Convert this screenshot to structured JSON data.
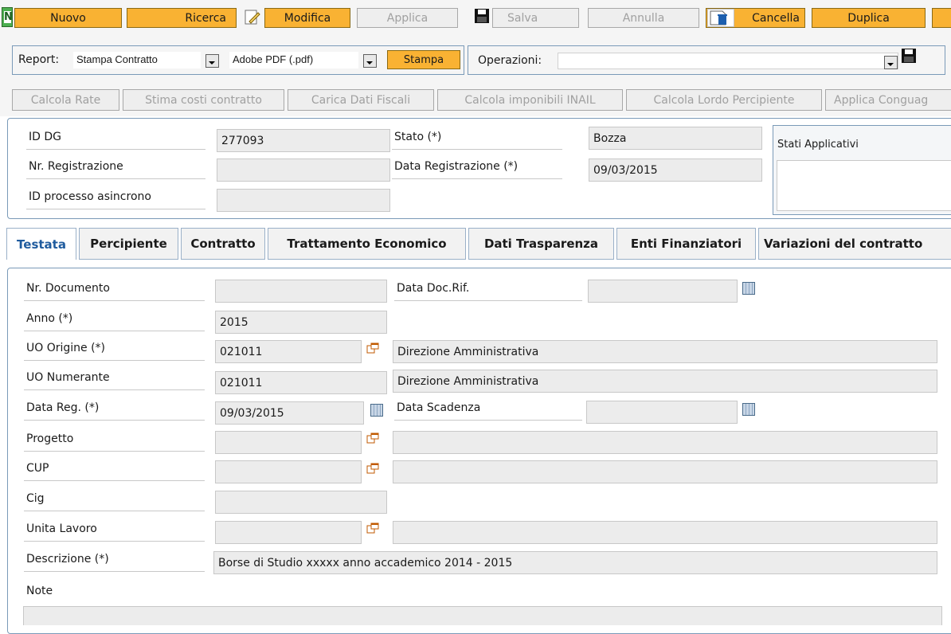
{
  "toolbar": {
    "nuovo": "Nuovo",
    "ricerca": "Ricerca",
    "modifica": "Modifica",
    "applica": "Applica",
    "salva": "Salva",
    "annulla": "Annulla",
    "cancella": "Cancella",
    "duplica": "Duplica"
  },
  "report": {
    "label": "Report:",
    "selected": "Stampa Contratto",
    "format": "Adobe PDF (.pdf)",
    "stampa": "Stampa",
    "operations_label": "Operazioni:",
    "operations_value": ""
  },
  "actions": [
    "Calcola Rate",
    "Stima costi contratto",
    "Carica Dati Fiscali",
    "Calcola imponibili INAIL",
    "Calcola Lordo Percipiente",
    "Applica Conguag"
  ],
  "header": {
    "id_dg_label": "ID DG",
    "id_dg_value": "277093",
    "nr_reg_label": "Nr. Registrazione",
    "nr_reg_value": "",
    "id_proc_label": "ID processo asincrono",
    "id_proc_value": "",
    "stato_label": "Stato (*)",
    "stato_value": "Bozza",
    "data_reg_label": "Data Registrazione (*)",
    "data_reg_value": "09/03/2015",
    "stati_applicativi": "Stati Applicativi"
  },
  "tabs": [
    "Testata",
    "Percipiente",
    "Contratto",
    "Trattamento Economico",
    "Dati Trasparenza",
    "Enti Finanziatori",
    "Variazioni del contratto"
  ],
  "form": {
    "nr_doc_label": "Nr. Documento",
    "nr_doc_value": "",
    "data_doc_rif_label": "Data Doc.Rif.",
    "data_doc_rif_value": "",
    "anno_label": "Anno (*)",
    "anno_value": "2015",
    "uo_origine_label": "UO Origine (*)",
    "uo_origine_code": "021011",
    "uo_origine_desc": "Direzione Amministrativa",
    "uo_numerante_label": "UO Numerante",
    "uo_numerante_code": "021011",
    "uo_numerante_desc": "Direzione Amministrativa",
    "data_reg_label": "Data Reg. (*)",
    "data_reg_value": "09/03/2015",
    "data_scadenza_label": "Data Scadenza",
    "data_scadenza_value": "",
    "progetto_label": "Progetto",
    "progetto_code": "",
    "progetto_desc": "",
    "cup_label": "CUP",
    "cup_code": "",
    "cup_desc": "",
    "cig_label": "Cig",
    "cig_value": "",
    "unita_lavoro_label": "Unita Lavoro",
    "unita_lavoro_code": "",
    "unita_lavoro_desc": "",
    "descrizione_label": "Descrizione (*)",
    "descrizione_value": "Borse di Studio xxxxx anno accademico 2014 - 2015",
    "note_label": "Note",
    "note_value": ""
  },
  "colors": {
    "button_orange": "#f9b233",
    "disabled_bg": "#eeeeee",
    "panel_border": "#7a9ab8",
    "active_tab_text": "#1f5b9e",
    "field_bg": "#ececec"
  },
  "icons": [
    "new-document-icon",
    "edit-pencil-icon",
    "save-disk-icon",
    "trash-bin-icon",
    "calendar-icon",
    "lookup-window-icon",
    "dropdown-arrow-icon"
  ]
}
